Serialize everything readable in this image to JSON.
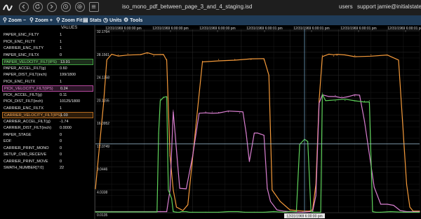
{
  "app": {
    "file_title": "iso_mono_pdf_between_page_3_and_4_staging.isd",
    "links": [
      "users",
      "support",
      "jamie@initialstate.com"
    ]
  },
  "toolbar": {
    "zoom_minus": "Zoom",
    "zoom_plus": "Zoom",
    "zoom_fit": "Zoom Fit",
    "stats": "Stats",
    "units": "Units",
    "tools": "Tools"
  },
  "panel": {
    "header": "VALUES",
    "rows": [
      {
        "name": "PAPER_ENC_FILTY",
        "value": "1"
      },
      {
        "name": "PICK_ENC_FILTY",
        "value": "1"
      },
      {
        "name": "CARRIER_ENC_FILTY",
        "value": "1"
      },
      {
        "name": "PAPER_ENC_FILTX",
        "value": "0"
      },
      {
        "name": "PAPER_VELOCITY_FILT(IPS)",
        "value": "13.91",
        "highlight": "green"
      },
      {
        "name": "PAPER_ACCEL_FILT(g)",
        "value": "0.60"
      },
      {
        "name": "PAPER_DIST_FILT(inch)",
        "value": "199/1800"
      },
      {
        "name": "PICK_ENC_FILTX",
        "value": "1"
      },
      {
        "name": "PICK_VELOCITY_FILT(IPS)",
        "value": "0.24",
        "highlight": "pink"
      },
      {
        "name": "PICK_ACCEL_FILT(g)",
        "value": "0.11"
      },
      {
        "name": "PICK_DIST_FILT(inch)",
        "value": "10125/1800"
      },
      {
        "name": "CARRIER_ENC_FILTX",
        "value": "1"
      },
      {
        "name": "CARRIER_VELOCITY_FILT(IPS)",
        "value": "1.03",
        "highlight": "orange"
      },
      {
        "name": "CARRIER_ACCEL_FILT(g)",
        "value": "-1.74"
      },
      {
        "name": "CARRIER_DIST_FILT(inch)",
        "value": "0.0000"
      },
      {
        "name": "PAPER_STAGE",
        "value": "0"
      },
      {
        "name": "EOF",
        "value": "0"
      },
      {
        "name": "CARRIER_PRINT_MONO",
        "value": "0"
      },
      {
        "name": "SETUP_CMD_RECEIVE",
        "value": "0"
      },
      {
        "name": "CARRIER_PRINT_MOVE",
        "value": "0"
      },
      {
        "name": "SWATH_NUMBER[7:0]",
        "value": "22"
      }
    ]
  },
  "chart_data": {
    "type": "line",
    "x_tick_labels": [
      "12/31/1969 6:00:00 pm",
      "12/31/1969 6:00:00 pm",
      "12/31/1969 6:00:00 pm",
      "12/31/1969 6:00:01 pm",
      "12/31/1969 6:00:01 pm",
      "12/31/1969 6:00:01 pm",
      "12/31/1969 6:00:01 pm"
    ],
    "cursor_label": "12/31/1969 6:00:00 pm",
    "y_tick_labels": [
      "32.1764",
      "28.1561",
      "24.1358",
      "20.1155",
      "16.0952",
      "12.0749",
      "8.0446",
      "4.0338",
      "0.0135"
    ],
    "ylim": [
      0.0135,
      32.1764
    ],
    "xlim": [
      0,
      100
    ],
    "cursor_x": 64.5,
    "crosshair_y": 12.07,
    "grid": true,
    "series": [
      {
        "name": "CARRIER_VELOCITY_FILT(IPS)",
        "color": "#f59a3a",
        "x": [
          0,
          2.5,
          3.5,
          5,
          7,
          10,
          14,
          16,
          18,
          21,
          22,
          23,
          24,
          25,
          27,
          28.5,
          33,
          38,
          43,
          48,
          52,
          53.5,
          54.5,
          57,
          60,
          64,
          66,
          67,
          68,
          69,
          70,
          72,
          73.5,
          74.5,
          77,
          80,
          85,
          90,
          93.5,
          96,
          97,
          98,
          100
        ],
        "y": [
          4.2,
          19,
          26.6,
          27.8,
          27.7,
          27.9,
          27.8,
          27.9,
          27.5,
          27.7,
          26.9,
          10,
          4,
          1,
          0.4,
          1.4,
          26.6,
          26.9,
          26.9,
          26.9,
          26.8,
          24,
          4,
          2,
          0.5,
          0.3,
          0.3,
          0.5,
          5,
          20,
          27.6,
          27.8,
          27.5,
          27.6,
          27.7,
          27.6,
          27.7,
          27.7,
          26.6,
          5,
          1,
          0.3,
          0.3
        ]
      },
      {
        "name": "PICK_VELOCITY_FILT(IPS)",
        "color": "#d97fd0",
        "x": [
          0,
          20,
          22,
          23,
          24,
          26,
          28,
          30,
          32,
          34,
          36,
          38,
          41,
          44.5,
          45.5,
          46.5,
          47.5,
          49,
          50,
          51,
          52,
          53,
          54,
          56,
          58,
          60,
          63,
          64,
          66,
          67,
          68,
          69,
          70,
          72,
          74,
          76,
          78,
          80,
          81.5,
          83,
          86,
          88,
          90,
          92,
          94,
          96,
          100
        ],
        "y": [
          0.2,
          0.2,
          0.2,
          4,
          18,
          4.3,
          4.2,
          10,
          17.4,
          17.7,
          17.7,
          17.6,
          17.7,
          17.5,
          17.6,
          14,
          9,
          14,
          14,
          13.8,
          13.6,
          4.3,
          2,
          0.5,
          0.3,
          0.2,
          0.1,
          0.1,
          0.2,
          0.2,
          3,
          19,
          20.5,
          20.4,
          20.6,
          20.4,
          20.4,
          20.5,
          20.4,
          16,
          4.5,
          1.5,
          1.5,
          1.3,
          0.4,
          0.2,
          0.2
        ]
      },
      {
        "name": "PAPER_VELOCITY_FILT(IPS)",
        "color": "#5fd35b",
        "x": [
          0,
          19,
          19.5,
          20,
          21,
          22,
          22.5,
          23.5,
          24,
          25,
          26,
          26.5,
          27,
          28,
          29,
          30,
          34,
          38,
          41,
          44,
          46,
          49,
          52,
          55,
          58,
          60,
          62,
          63,
          64.5,
          65.5,
          66.5,
          67.5,
          68.5,
          69.5,
          70,
          71,
          74,
          77,
          80,
          83,
          84.5,
          85.5,
          86.5,
          88,
          91,
          95,
          100
        ],
        "y": [
          0.15,
          0.15,
          14,
          19.9,
          20.3,
          20.2,
          4,
          2.5,
          0.2,
          0.1,
          0.1,
          0.2,
          0.2,
          0.2,
          0.1,
          0.1,
          0.1,
          0.1,
          0.2,
          0.2,
          0.1,
          0.1,
          0.1,
          0.2,
          0.1,
          0.2,
          0.2,
          12,
          12.9,
          12.5,
          0.2,
          0.1,
          0.1,
          0.1,
          21,
          19.7,
          19.6,
          19.7,
          19.6,
          19.6,
          19.7,
          0.2,
          0.1,
          0.1,
          0.2,
          0.1,
          0.1
        ]
      }
    ]
  }
}
